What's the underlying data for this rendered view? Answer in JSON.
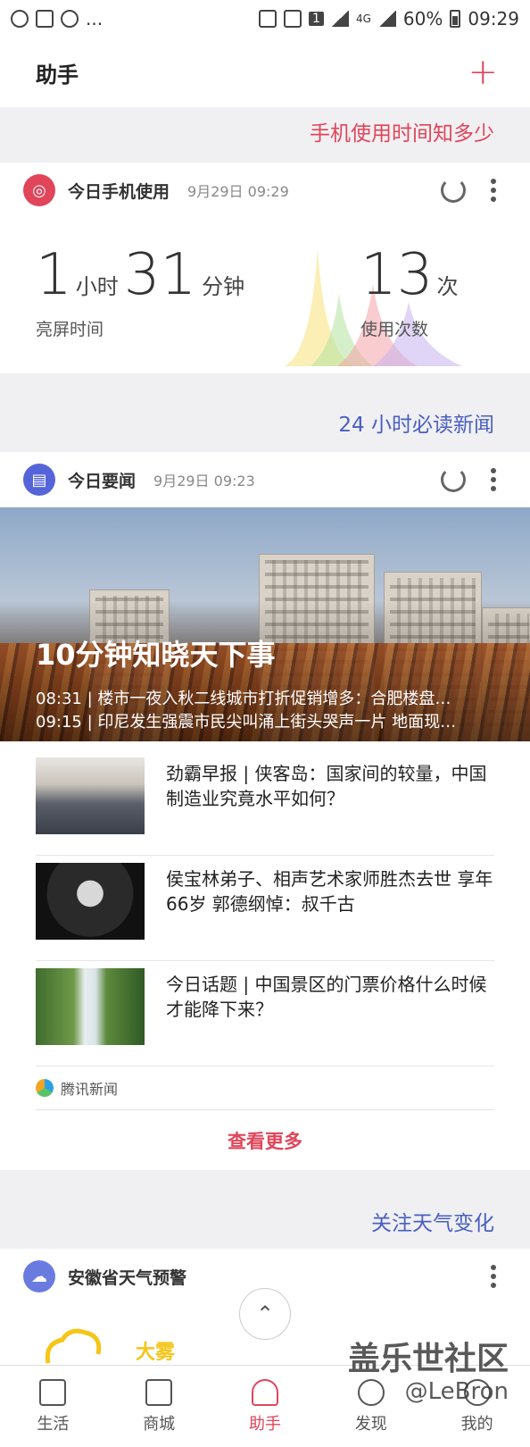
{
  "status_bar": {
    "battery": "60%",
    "time": "09:29",
    "network": "4G",
    "sim": "1"
  },
  "app_bar": {
    "title": "助手",
    "add_icon": "plus-icon"
  },
  "sections": {
    "usage_link": "手机使用时间知多少",
    "news_link": "24 小时必读新闻",
    "weather_link": "关注天气变化"
  },
  "usage_card": {
    "title": "今日手机使用",
    "time": "9月29日 09:29",
    "hours": "1",
    "hours_unit": "小时",
    "minutes": "31",
    "minutes_unit": "分钟",
    "screen_label": "亮屏时间",
    "count": "13",
    "count_unit": "次",
    "count_label": "使用次数"
  },
  "news_card": {
    "title": "今日要闻",
    "time": "9月29日 09:23",
    "hero_title": "10分钟知晓天下事",
    "hero_lines": [
      "08:31 | 楼市一夜入秋二线城市打折促销增多：合肥楼盘…",
      "09:15 | 印尼发生强震市民尖叫涌上街头哭声一片 地面现…"
    ],
    "items": [
      {
        "text": "劲霸早报 | 侠客岛：国家间的较量，中国制造业究竟水平如何？"
      },
      {
        "text": "侯宝林弟子、相声艺术家师胜杰去世 享年66岁 郭德纲悼：叔千古"
      },
      {
        "text": "今日话题 | 中国景区的门票价格什么时候才能降下来？"
      }
    ],
    "source": "腾讯新闻",
    "more": "查看更多"
  },
  "weather_card": {
    "title": "安徽省天气预警",
    "condition": "大雾"
  },
  "nav": [
    {
      "label": "生活",
      "icon": "news-icon"
    },
    {
      "label": "商城",
      "icon": "bag-icon"
    },
    {
      "label": "助手",
      "icon": "heart-icon"
    },
    {
      "label": "发现",
      "icon": "compass-icon"
    },
    {
      "label": "我的",
      "icon": "person-icon"
    }
  ],
  "watermark": {
    "line1": "盖乐世社区",
    "line2": "@LeBron"
  },
  "colors": {
    "accent": "#e0455a",
    "news_link": "#4a5fc0",
    "usage_icon": "#e0455a",
    "news_icon": "#5564d8",
    "weather_icon": "#6a7be0",
    "weather_sun": "#f5c518"
  }
}
